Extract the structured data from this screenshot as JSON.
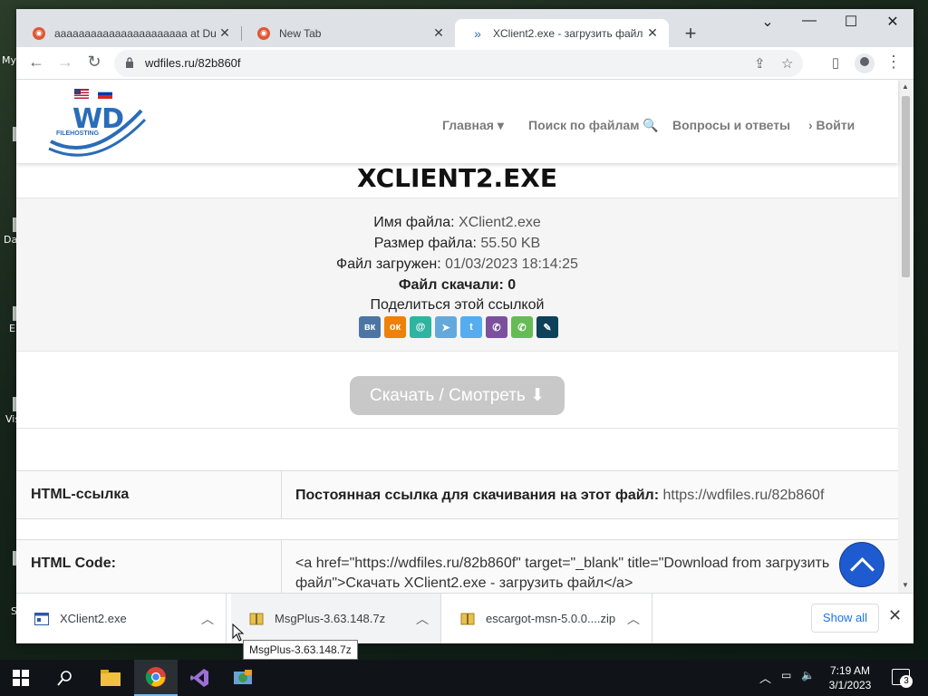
{
  "desktop": {
    "icon_labels": [
      "My",
      "Da",
      "E",
      "Vis",
      "S"
    ]
  },
  "browser": {
    "tabs": [
      {
        "title": "аааааааааааааааааааааа at Duc",
        "close": "✕"
      },
      {
        "title": "New Tab",
        "close": "✕"
      },
      {
        "title": "XClient2.exe - загрузить файл",
        "close": "✕"
      }
    ],
    "new_tab": "+",
    "window_controls": {
      "dropdown": "⌄",
      "minimize": "—",
      "maximize": "☐",
      "close": "✕"
    },
    "url": "wdfiles.ru/82b860f"
  },
  "site": {
    "logo_text": "WD",
    "logo_subtext": "FILEHOSTING",
    "nav": [
      {
        "label": "Главная ▾"
      },
      {
        "label": "Поиск по файлам 🔍"
      },
      {
        "label": "Вопросы и ответы"
      },
      {
        "label": "› Войти"
      }
    ]
  },
  "file": {
    "heading": "XCLIENT2.EXE",
    "name_label": "Имя файла:",
    "name_value": "XClient2.exe",
    "size_label": "Размер файла:",
    "size_value": "55.50 KB",
    "uploaded_label": "Файл загружен:",
    "uploaded_value": "01/03/2023 18:14:25",
    "downloads_label": "Файл скачали: 0",
    "share_label": "Поделиться этой ссылкой",
    "download_button": "Скачать / Смотреть ⬇"
  },
  "share_icons": [
    {
      "name": "vk-icon",
      "glyph": "вк",
      "color": "#4c75a3"
    },
    {
      "name": "odnoklassniki-icon",
      "glyph": "ок",
      "color": "#ee8208"
    },
    {
      "name": "moimir-icon",
      "glyph": "@",
      "color": "#2fb4a2"
    },
    {
      "name": "telegram-icon",
      "glyph": "➤",
      "color": "#64a9dc"
    },
    {
      "name": "twitter-icon",
      "glyph": "t",
      "color": "#55acee"
    },
    {
      "name": "viber-icon",
      "glyph": "✆",
      "color": "#7b519d"
    },
    {
      "name": "whatsapp-icon",
      "glyph": "✆",
      "color": "#65bc54"
    },
    {
      "name": "livejournal-icon",
      "glyph": "✎",
      "color": "#0d425a"
    }
  ],
  "table": {
    "rows": [
      {
        "key": "HTML-ссылка",
        "value_bold": "Постоянная ссылка для скачивания на этот файл:",
        "value_link": "https://wdfiles.ru/82b860f"
      },
      {
        "key": "HTML Code:",
        "value_line1": "<a href=\"https://wdfiles.ru/82b860f\" target=\"_blank\" title=\"Download from загрузить",
        "value_line2": "файл\">Скачать XClient2.exe - загрузить файл</a>"
      }
    ]
  },
  "downloads": {
    "items": [
      {
        "name": "XClient2.exe"
      },
      {
        "name": "MsgPlus-3.63.148.7z"
      },
      {
        "name": "escargot-msn-5.0.0....zip"
      }
    ],
    "show_all": "Show all",
    "close": "✕",
    "tooltip": "MsgPlus-3.63.148.7z"
  },
  "taskbar": {
    "time": "7:19 AM",
    "date": "3/1/2023",
    "notifications": "3"
  }
}
